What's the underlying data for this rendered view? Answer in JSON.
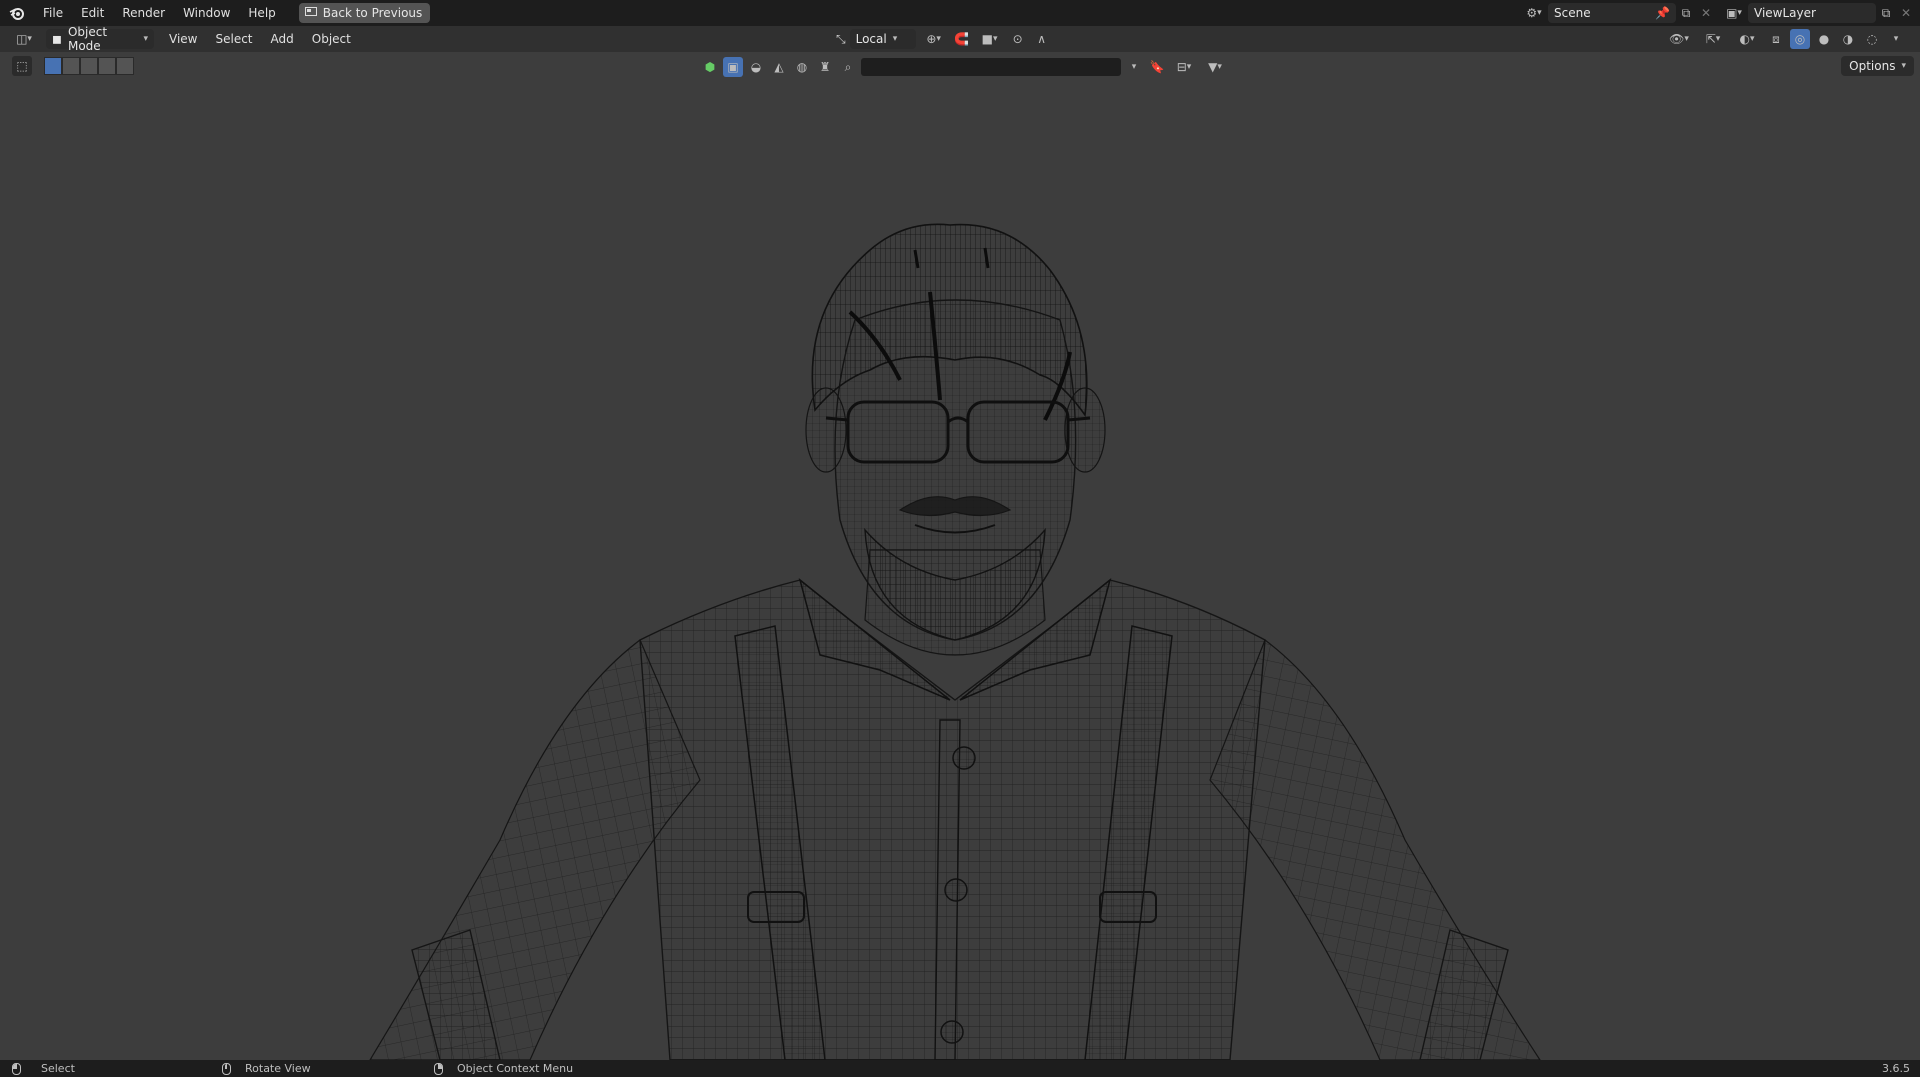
{
  "topbar": {
    "menus": [
      "File",
      "Edit",
      "Render",
      "Window",
      "Help"
    ],
    "back_button": "Back to Previous",
    "scene": "Scene",
    "view_layer": "ViewLayer"
  },
  "header": {
    "mode": "Object Mode",
    "menus": [
      "View",
      "Select",
      "Add",
      "Object"
    ],
    "transform_orientation": "Local"
  },
  "toolheader": {
    "options": "Options",
    "search_placeholder": ""
  },
  "statusbar": {
    "left": "Select",
    "middle": "Rotate View",
    "right": "Object Context Menu",
    "version": "3.6.5"
  },
  "colors": {
    "topbar_bg": "#1d1d1d",
    "header_bg": "#303030",
    "viewport_bg": "#3d3d3d",
    "wire": "#111111",
    "accent": "#4772b3"
  }
}
